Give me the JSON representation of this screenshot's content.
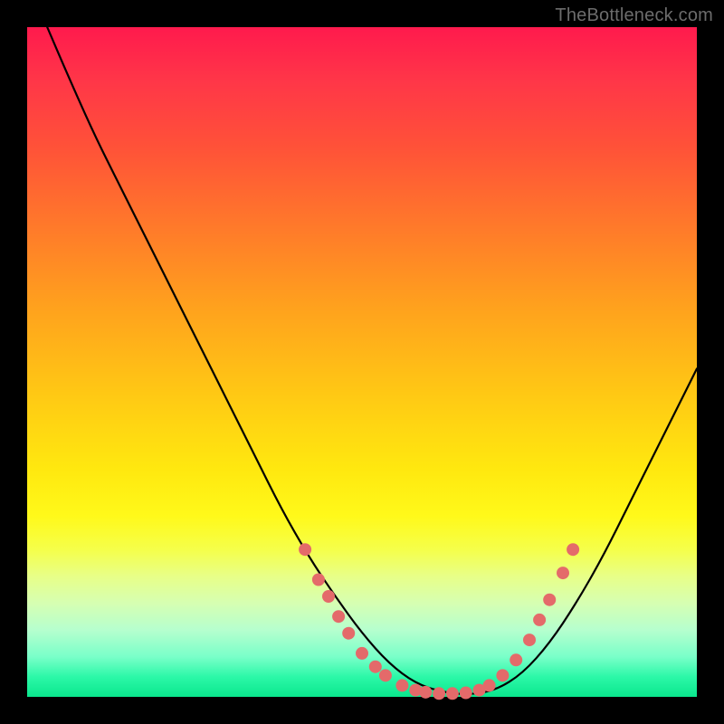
{
  "watermark": "TheBottleneck.com",
  "colors": {
    "frame": "#000000",
    "curve_stroke": "#000000",
    "marker_fill": "#e46a6a",
    "marker_stroke": "#c94e4e",
    "gradient_top": "#ff1a4d",
    "gradient_bottom": "#0ae78d"
  },
  "chart_data": {
    "type": "line",
    "title": "",
    "xlabel": "",
    "ylabel": "",
    "xlim": [
      0,
      100
    ],
    "ylim": [
      0,
      100
    ],
    "grid": false,
    "legend": false,
    "series": [
      {
        "name": "bottleneck-curve",
        "x": [
          3,
          6,
          10,
          14,
          18,
          22,
          26,
          30,
          34,
          38,
          42,
          46,
          50,
          54,
          58,
          62,
          66,
          70,
          74,
          78,
          82,
          86,
          90,
          94,
          98,
          100
        ],
        "y": [
          100,
          93,
          84,
          76,
          68,
          60,
          52,
          44,
          36,
          28,
          21,
          15,
          9.5,
          5,
          2,
          0.7,
          0.3,
          1.0,
          3.5,
          8,
          14,
          21,
          29,
          37,
          45,
          49
        ]
      }
    ],
    "markers": [
      {
        "x": 41.5,
        "y": 22
      },
      {
        "x": 43.5,
        "y": 17.5
      },
      {
        "x": 45.0,
        "y": 15
      },
      {
        "x": 46.5,
        "y": 12
      },
      {
        "x": 48.0,
        "y": 9.5
      },
      {
        "x": 50.0,
        "y": 6.5
      },
      {
        "x": 52.0,
        "y": 4.5
      },
      {
        "x": 53.5,
        "y": 3.2
      },
      {
        "x": 56.0,
        "y": 1.7
      },
      {
        "x": 58.0,
        "y": 1.0
      },
      {
        "x": 59.5,
        "y": 0.7
      },
      {
        "x": 61.5,
        "y": 0.5
      },
      {
        "x": 63.5,
        "y": 0.5
      },
      {
        "x": 65.5,
        "y": 0.6
      },
      {
        "x": 67.5,
        "y": 1.0
      },
      {
        "x": 69.0,
        "y": 1.7
      },
      {
        "x": 71.0,
        "y": 3.2
      },
      {
        "x": 73.0,
        "y": 5.5
      },
      {
        "x": 75.0,
        "y": 8.5
      },
      {
        "x": 76.5,
        "y": 11.5
      },
      {
        "x": 78.0,
        "y": 14.5
      },
      {
        "x": 80.0,
        "y": 18.5
      },
      {
        "x": 81.5,
        "y": 22
      }
    ]
  }
}
